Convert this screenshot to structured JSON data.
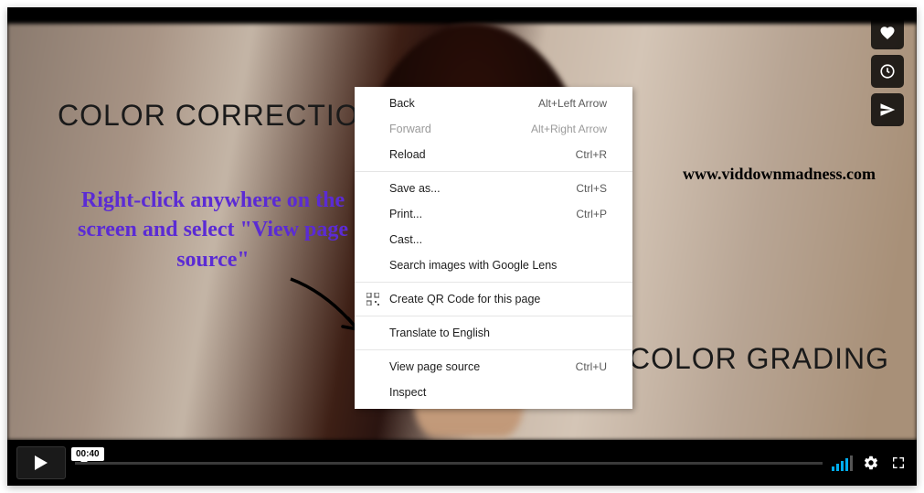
{
  "video": {
    "title_left": "COLOR CORRECTION",
    "title_right": "COLOR GRADING",
    "watermark": "www.viddownmadness.com"
  },
  "annotation": {
    "text": "Right-click anywhere on the screen and select \"View page source\""
  },
  "context_menu": {
    "items": [
      {
        "label": "Back",
        "shortcut": "Alt+Left Arrow",
        "disabled": false
      },
      {
        "label": "Forward",
        "shortcut": "Alt+Right Arrow",
        "disabled": true
      },
      {
        "label": "Reload",
        "shortcut": "Ctrl+R",
        "disabled": false
      },
      {
        "label": "Save as...",
        "shortcut": "Ctrl+S",
        "disabled": false
      },
      {
        "label": "Print...",
        "shortcut": "Ctrl+P",
        "disabled": false
      },
      {
        "label": "Cast...",
        "shortcut": "",
        "disabled": false
      },
      {
        "label": "Search images with Google Lens",
        "shortcut": "",
        "disabled": false
      },
      {
        "label": "Create QR Code for this page",
        "shortcut": "",
        "disabled": false,
        "icon": "qr"
      },
      {
        "label": "Translate to English",
        "shortcut": "",
        "disabled": false
      },
      {
        "label": "View page source",
        "shortcut": "Ctrl+U",
        "disabled": false
      },
      {
        "label": "Inspect",
        "shortcut": "",
        "disabled": false
      }
    ]
  },
  "player": {
    "current_time": "00:40"
  }
}
